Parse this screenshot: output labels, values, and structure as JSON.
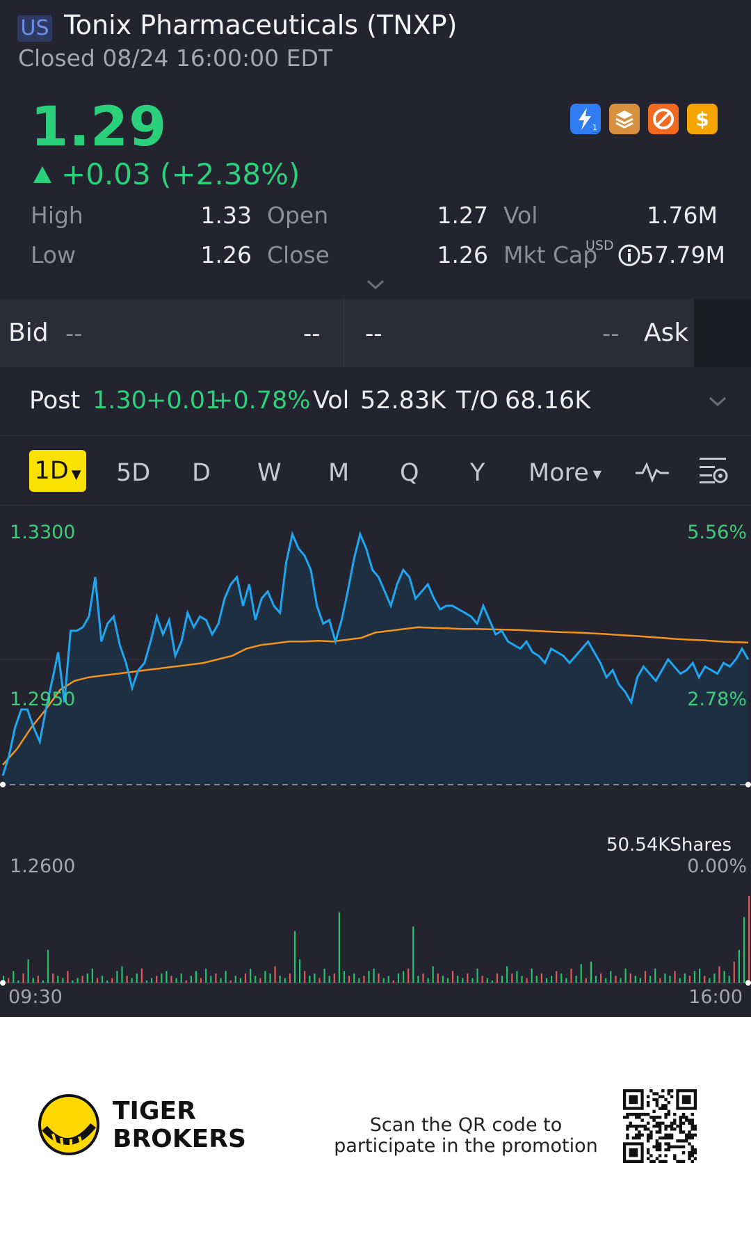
{
  "header": {
    "market_badge": "US",
    "title": "Tonix Pharmaceuticals (TNXP)",
    "status": "Closed 08/24 16:00:00 EDT",
    "price": "1.29",
    "change": "+0.03 (+2.38%)",
    "icons": [
      "lightning-icon",
      "stack-icon",
      "no-margin-icon",
      "dollar-icon"
    ],
    "stats": {
      "high_label": "High",
      "high": "1.33",
      "low_label": "Low",
      "low": "1.26",
      "open_label": "Open",
      "open": "1.27",
      "close_label": "Close",
      "close": "1.26",
      "vol_label": "Vol",
      "vol": "1.76M",
      "mktcap_label": "Mkt Cap",
      "mktcap_currency": "USD",
      "mktcap": "57.79M"
    }
  },
  "bidask": {
    "bid_label": "Bid",
    "bid_price": "--",
    "bid_size": "--",
    "ask_price": "--",
    "ask_size": "--",
    "ask_label": "Ask"
  },
  "post": {
    "label": "Post",
    "price": "1.30",
    "change": "+0.01",
    "change_pct": "+0.78%",
    "vol_label": "Vol",
    "vol": "52.83K",
    "to_label": "T/O",
    "to": "68.16K"
  },
  "tabs": {
    "active": "1D",
    "items": [
      "5D",
      "D",
      "W",
      "M",
      "Q",
      "Y"
    ],
    "more": "More"
  },
  "chart_data": {
    "type": "line",
    "y_left_labels": [
      "1.3300",
      "1.2950",
      "1.2600"
    ],
    "y_right_labels": [
      "5.56%",
      "2.78%",
      "0.00%"
    ],
    "x_labels": [
      "09:30",
      "16:00"
    ],
    "volume_readout": "50.54KShares",
    "ylim": [
      1.26,
      1.33
    ],
    "series": [
      {
        "values": [
          1.2625,
          1.268,
          1.276,
          1.281,
          1.281,
          1.276,
          1.272,
          1.281,
          1.289,
          1.297,
          1.283,
          1.303,
          1.303,
          1.304,
          1.307,
          1.318,
          1.3,
          1.305,
          1.307,
          1.299,
          1.294,
          1.287,
          1.292,
          1.294,
          1.3,
          1.307,
          1.302,
          1.306,
          1.296,
          1.3,
          1.308,
          1.304,
          1.307,
          1.306,
          1.302,
          1.305,
          1.312,
          1.316,
          1.318,
          1.31,
          1.316,
          1.306,
          1.312,
          1.314,
          1.31,
          1.308,
          1.322,
          1.33,
          1.326,
          1.324,
          1.32,
          1.31,
          1.305,
          1.306,
          1.3,
          1.306,
          1.314,
          1.323,
          1.33,
          1.326,
          1.32,
          1.318,
          1.314,
          1.31,
          1.316,
          1.32,
          1.318,
          1.312,
          1.314,
          1.316,
          1.312,
          1.309,
          1.31,
          1.31,
          1.309,
          1.308,
          1.307,
          1.305,
          1.31,
          1.306,
          1.302,
          1.303,
          1.3,
          1.299,
          1.298,
          1.3,
          1.297,
          1.296,
          1.294,
          1.298,
          1.297,
          1.296,
          1.294,
          1.296,
          1.298,
          1.3,
          1.297,
          1.294,
          1.29,
          1.292,
          1.288,
          1.286,
          1.283,
          1.29,
          1.293,
          1.291,
          1.289,
          1.292,
          1.295,
          1.293,
          1.291,
          1.292,
          1.294,
          1.29,
          1.293,
          1.292,
          1.291,
          1.294,
          1.293,
          1.295,
          1.298,
          1.295
        ],
        "color": "#1ea7f0"
      },
      {
        "values": [
          1.2655,
          1.27,
          1.276,
          1.281,
          1.2865,
          1.289,
          1.29,
          1.2905,
          1.291,
          1.2915,
          1.292,
          1.2925,
          1.293,
          1.2935,
          1.294,
          1.295,
          1.296,
          1.298,
          1.299,
          1.2995,
          1.3,
          1.3,
          1.3002,
          1.3,
          1.3005,
          1.301,
          1.3025,
          1.303,
          1.3035,
          1.304,
          1.3038,
          1.3037,
          1.3035,
          1.3035,
          1.3034,
          1.3033,
          1.3032,
          1.303,
          1.3028,
          1.3026,
          1.3025,
          1.3023,
          1.3021,
          1.3018,
          1.3016,
          1.3013,
          1.301,
          1.3007,
          1.3005,
          1.3003,
          1.3,
          1.2998,
          1.2997
        ],
        "color": "#f0941e"
      }
    ],
    "volume": {
      "bars": [
        3,
        2,
        5,
        1,
        4,
        10,
        2,
        3,
        1,
        14,
        4,
        3,
        2,
        5,
        1,
        2,
        3,
        4,
        6,
        2,
        3,
        1,
        2,
        5,
        7,
        3,
        2,
        4,
        6,
        1,
        2,
        3,
        4,
        5,
        3,
        2,
        4,
        1,
        3,
        5,
        2,
        6,
        3,
        4,
        2,
        5,
        1,
        3,
        2,
        4,
        6,
        3,
        2,
        5,
        4,
        7,
        3,
        2,
        4,
        22,
        10,
        5,
        3,
        4,
        2,
        6,
        3,
        4,
        30,
        5,
        3,
        4,
        2,
        3,
        5,
        6,
        4,
        2,
        3,
        1,
        4,
        5,
        6,
        24,
        3,
        4,
        2,
        7,
        4,
        3,
        2,
        5,
        3,
        2,
        4,
        2,
        6,
        3,
        2,
        1,
        4,
        3,
        7,
        4,
        5,
        3,
        2,
        6,
        3,
        4,
        2,
        3,
        5,
        4,
        2,
        6,
        3,
        8,
        2,
        9,
        3,
        4,
        2,
        5,
        3,
        2,
        6,
        4,
        3,
        2,
        5,
        3,
        6,
        2,
        4,
        3,
        5,
        2,
        4,
        3,
        5,
        6,
        3,
        2,
        4,
        7,
        5,
        3,
        9,
        14,
        28,
        37
      ],
      "up_color": "#25c26b",
      "down_color": "#e05a5a"
    }
  },
  "footer": {
    "brand_line1": "TIGER",
    "brand_line2": "BROKERS",
    "promo_line1": "Scan the QR code to",
    "promo_line2": "participate in the promotion"
  }
}
